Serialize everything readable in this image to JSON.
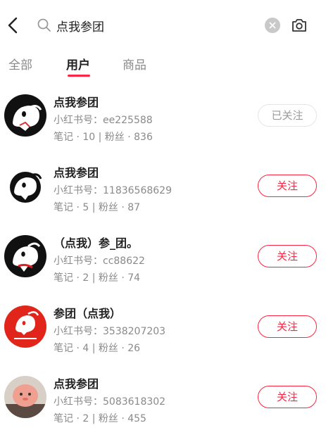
{
  "search": {
    "query": "点我参团"
  },
  "tabs": [
    {
      "label": "全部"
    },
    {
      "label": "用户"
    },
    {
      "label": "商品"
    }
  ],
  "users": [
    {
      "name": "点我参团",
      "id_label": "小红书号：ee225588",
      "stats": "笔记 · 10 | 粉丝 · 836",
      "button": "已关注"
    },
    {
      "name": "点我参团",
      "id_label": "小红书号：11836568629",
      "stats": "笔记 · 5 | 粉丝 · 87",
      "button": "关注"
    },
    {
      "name": "（点我）参_团。",
      "id_label": "小红书号：cc88622",
      "stats": "笔记 · 2 | 粉丝 · 74",
      "button": "关注"
    },
    {
      "name": "参团（点我）",
      "id_label": "小红书号：3538207203",
      "stats": "笔记 · 4 | 粉丝 · 26",
      "button": "关注"
    },
    {
      "name": "点我参团",
      "id_label": "小红书号：5083618302",
      "stats": "笔记 · 2 | 粉丝 · 455",
      "button": "关注"
    }
  ],
  "icons": {
    "back": "back-arrow-icon",
    "search": "search-icon",
    "clear": "clear-icon",
    "camera": "camera-icon"
  },
  "colors": {
    "accent": "#ff2442",
    "muted": "#8a8a8a"
  }
}
